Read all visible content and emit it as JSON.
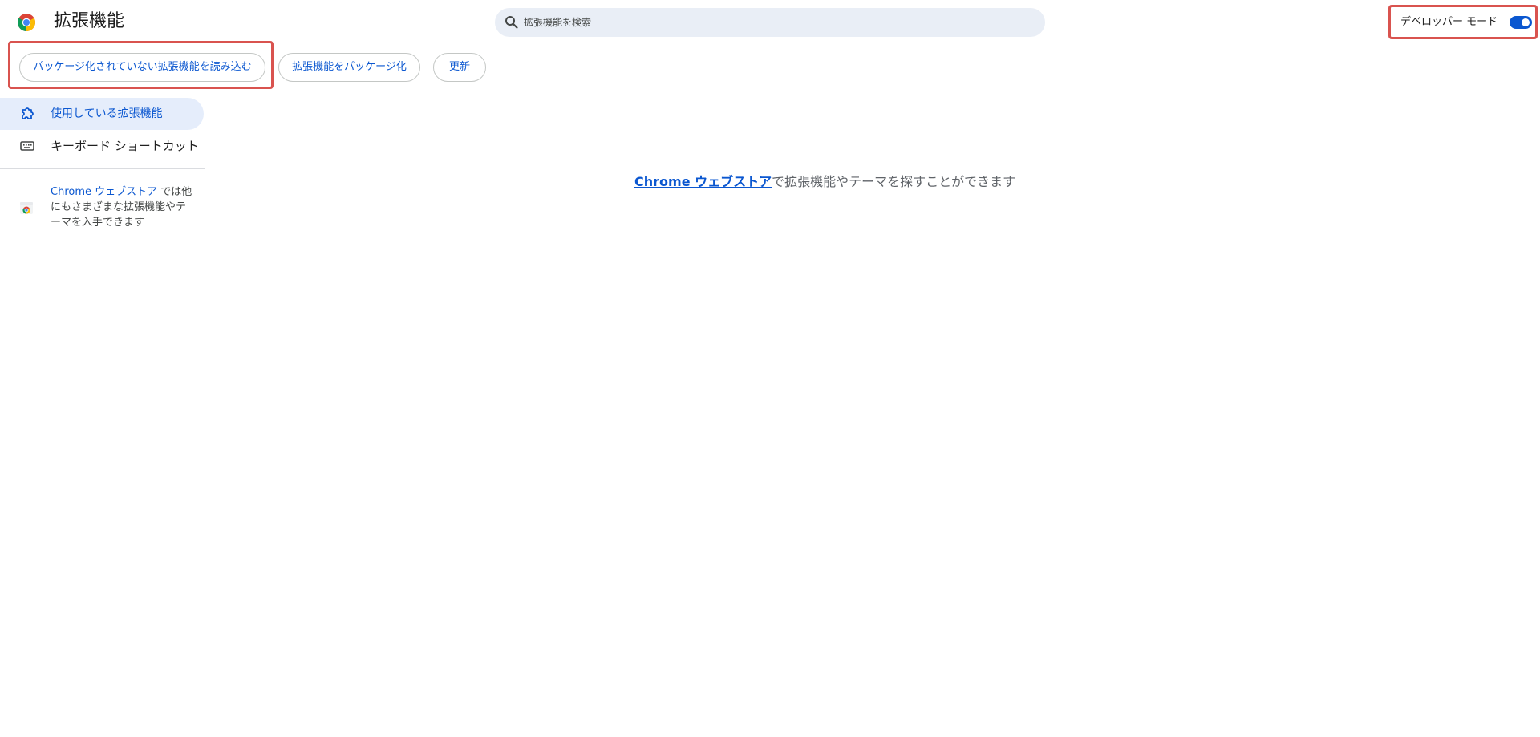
{
  "header": {
    "title": "拡張機能",
    "search_placeholder": "拡張機能を検索",
    "dev_mode_label": "デベロッパー モード",
    "dev_mode_on": true
  },
  "toolbar": {
    "load_unpacked_label": "パッケージ化されていない拡張機能を読み込む",
    "pack_label": "拡張機能をパッケージ化",
    "update_label": "更新"
  },
  "sidebar": {
    "items": [
      {
        "label": "使用している拡張機能",
        "active": true
      },
      {
        "label": "キーボード ショートカット",
        "active": false
      }
    ],
    "store_promo": {
      "link": "Chrome ウェブストア",
      "text": " では他にもさまざまな拡張機能やテーマを入手できます"
    }
  },
  "main": {
    "empty_link": "Chrome ウェブストア",
    "empty_text": "で拡張機能やテーマを探すことができます"
  },
  "colors": {
    "accent": "#0b57d0",
    "highlight": "#d9534f",
    "search_bg": "#e9eef6",
    "active_bg": "#e5edfb"
  }
}
